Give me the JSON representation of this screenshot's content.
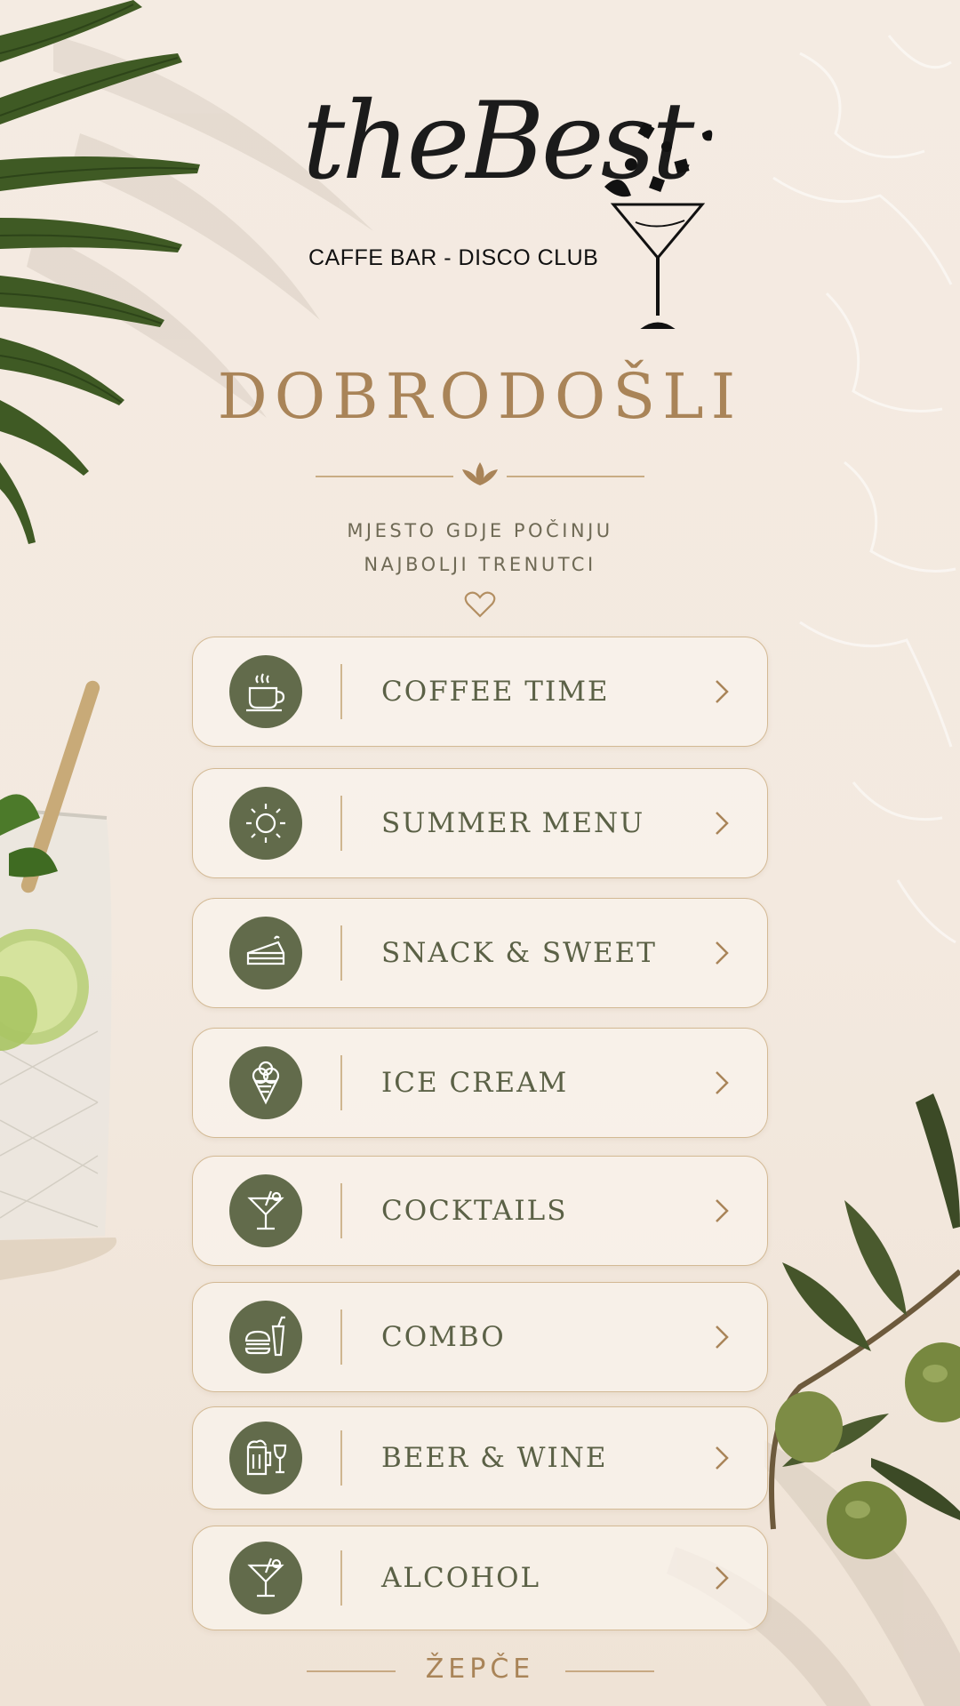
{
  "brand": {
    "script": "theBest",
    "subtitle": "CAFFE BAR - DISCO CLUB"
  },
  "welcome": "DOBRODOŠLI",
  "tagline": {
    "line1": "MJESTO GDJE POČINJU",
    "line2": "NAJBOLJI TRENUTCI"
  },
  "menu": [
    {
      "label": "COFFEE TIME",
      "icon": "coffee-cup-icon"
    },
    {
      "label": "SUMMER MENU",
      "icon": "sun-icon"
    },
    {
      "label": "SNACK & SWEET",
      "icon": "cake-slice-icon"
    },
    {
      "label": "ICE CREAM",
      "icon": "ice-cream-icon"
    },
    {
      "label": "COCKTAILS",
      "icon": "cocktail-icon"
    },
    {
      "label": "COMBO",
      "icon": "burger-drink-icon"
    },
    {
      "label": "BEER & WINE",
      "icon": "beer-wine-icon"
    },
    {
      "label": "ALCOHOL",
      "icon": "cocktail-icon"
    }
  ],
  "footer": "ŽEPČE",
  "colors": {
    "accent_gold": "#a98458",
    "olive": "#626b4b",
    "label_text": "#5b6146",
    "background": "#f4ebe2"
  }
}
